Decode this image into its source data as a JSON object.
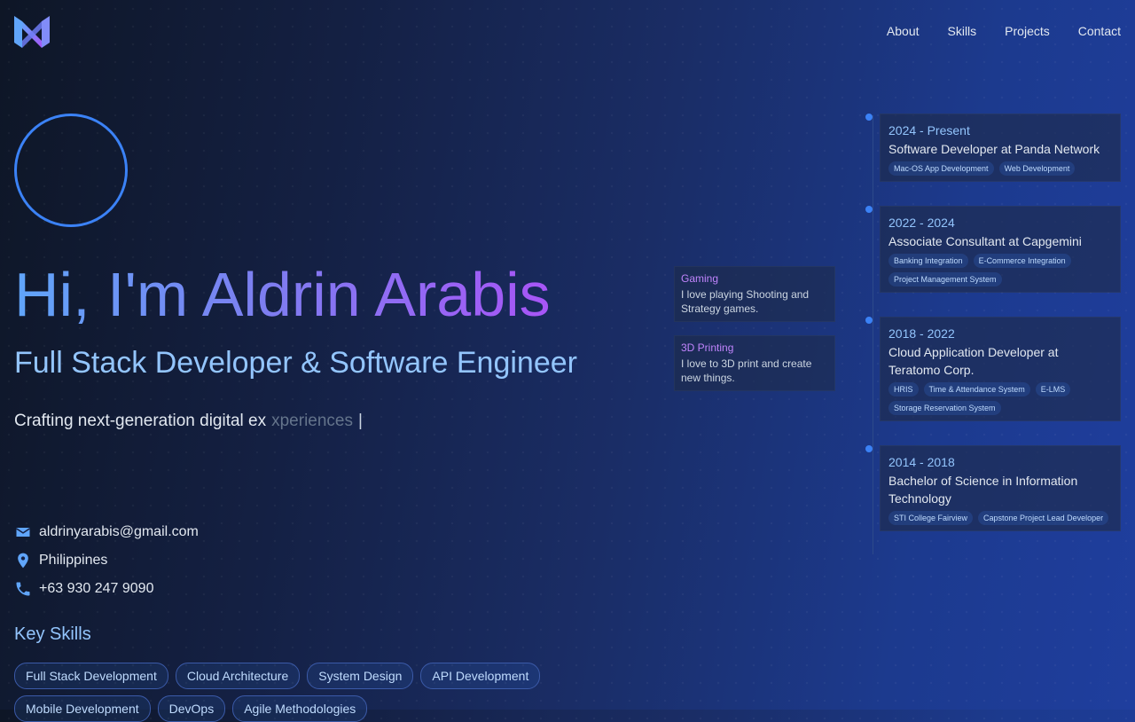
{
  "nav": {
    "items": [
      "About",
      "Skills",
      "Projects",
      "Contact"
    ]
  },
  "hero": {
    "title": "Hi, I'm Aldrin Arabis",
    "subtitle": "Full Stack Developer & Software Engineer",
    "tagline_typed": "Crafting next-generation digital ex",
    "tagline_ghost": "xperiences",
    "cursor": "|"
  },
  "contact": {
    "email": "aldrinyarabis@gmail.com",
    "location": "Philippines",
    "phone": "+63 930 247 9090"
  },
  "skills": {
    "title": "Key Skills",
    "items": [
      "Full Stack Development",
      "Cloud Architecture",
      "System Design",
      "API Development",
      "Mobile Development",
      "DevOps",
      "Agile Methodologies"
    ]
  },
  "hobbies": [
    {
      "title": "Gaming",
      "desc": "I love playing Shooting and Strategy games."
    },
    {
      "title": "3D Printing",
      "desc": "I love to 3D print and create new things."
    }
  ],
  "timeline": [
    {
      "date": "2024 - Present",
      "title": "Software Developer at Panda Network",
      "tags": [
        "Mac-OS App Development",
        "Web Development"
      ]
    },
    {
      "date": "2022 - 2024",
      "title": "Associate Consultant at Capgemini",
      "tags": [
        "Banking Integration",
        "E-Commerce Integration",
        "Project Management System"
      ]
    },
    {
      "date": "2018 - 2022",
      "title": "Cloud Application Developer at Teratomo Corp.",
      "tags": [
        "HRIS",
        "Time & Attendance System",
        "E-LMS",
        "Storage Reservation System"
      ]
    },
    {
      "date": "2014 - 2018",
      "title": "Bachelor of Science in Information Technology",
      "tags": [
        "STI College Fairview",
        "Capstone Project Lead Developer"
      ]
    }
  ],
  "colors": {
    "accent": "#3b82f6",
    "accent_light": "#93c5fd",
    "purple": "#a855f7"
  }
}
